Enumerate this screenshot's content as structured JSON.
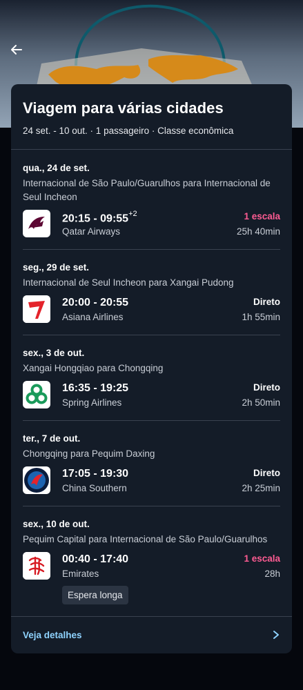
{
  "header": {
    "back_icon": "arrow-left-icon"
  },
  "trip": {
    "title": "Viagem para várias cidades",
    "summary": "24 set. - 10 out. · 1 passageiro · Classe econômica"
  },
  "segments": [
    {
      "date": "qua., 24 de set.",
      "route": "Internacional de São Paulo/Guarulhos para Internacional de Seul Incheon",
      "times": "20:15 - 09:55",
      "day_offset": "+2",
      "airline": "Qatar Airways",
      "stops": "1 escala",
      "duration": "25h 40min",
      "logo": "qatar-airways-logo"
    },
    {
      "date": "seg., 29 de set.",
      "route": "Internacional de Seul Incheon para Xangai Pudong",
      "times": "20:00 - 20:55",
      "airline": "Asiana Airlines",
      "stops": "Direto",
      "duration": "1h 55min",
      "logo": "asiana-airlines-logo"
    },
    {
      "date": "sex., 3 de out.",
      "route": "Xangai Hongqiao para Chongqing",
      "times": "16:35 - 19:25",
      "airline": "Spring Airlines",
      "stops": "Direto",
      "duration": "2h 50min",
      "logo": "spring-airlines-logo"
    },
    {
      "date": "ter., 7 de out.",
      "route": "Chongqing para Pequim Daxing",
      "times": "17:05 - 19:30",
      "airline": "China Southern",
      "stops": "Direto",
      "duration": "2h 25min",
      "logo": "china-southern-logo"
    },
    {
      "date": "sex., 10 de out.",
      "route": "Pequim Capital para Internacional de São Paulo/Guarulhos",
      "times": "00:40 - 17:40",
      "airline": "Emirates",
      "stops": "1 escala",
      "duration": "28h",
      "badge": "Espera longa",
      "logo": "emirates-logo"
    }
  ],
  "footer": {
    "details_label": "Veja detalhes",
    "chevron_icon": "chevron-right-icon"
  },
  "colors": {
    "card_bg": "#141c28",
    "page_bg": "#05070d",
    "stop_accent": "#ff5c93",
    "link_accent": "#8fd3ff"
  }
}
